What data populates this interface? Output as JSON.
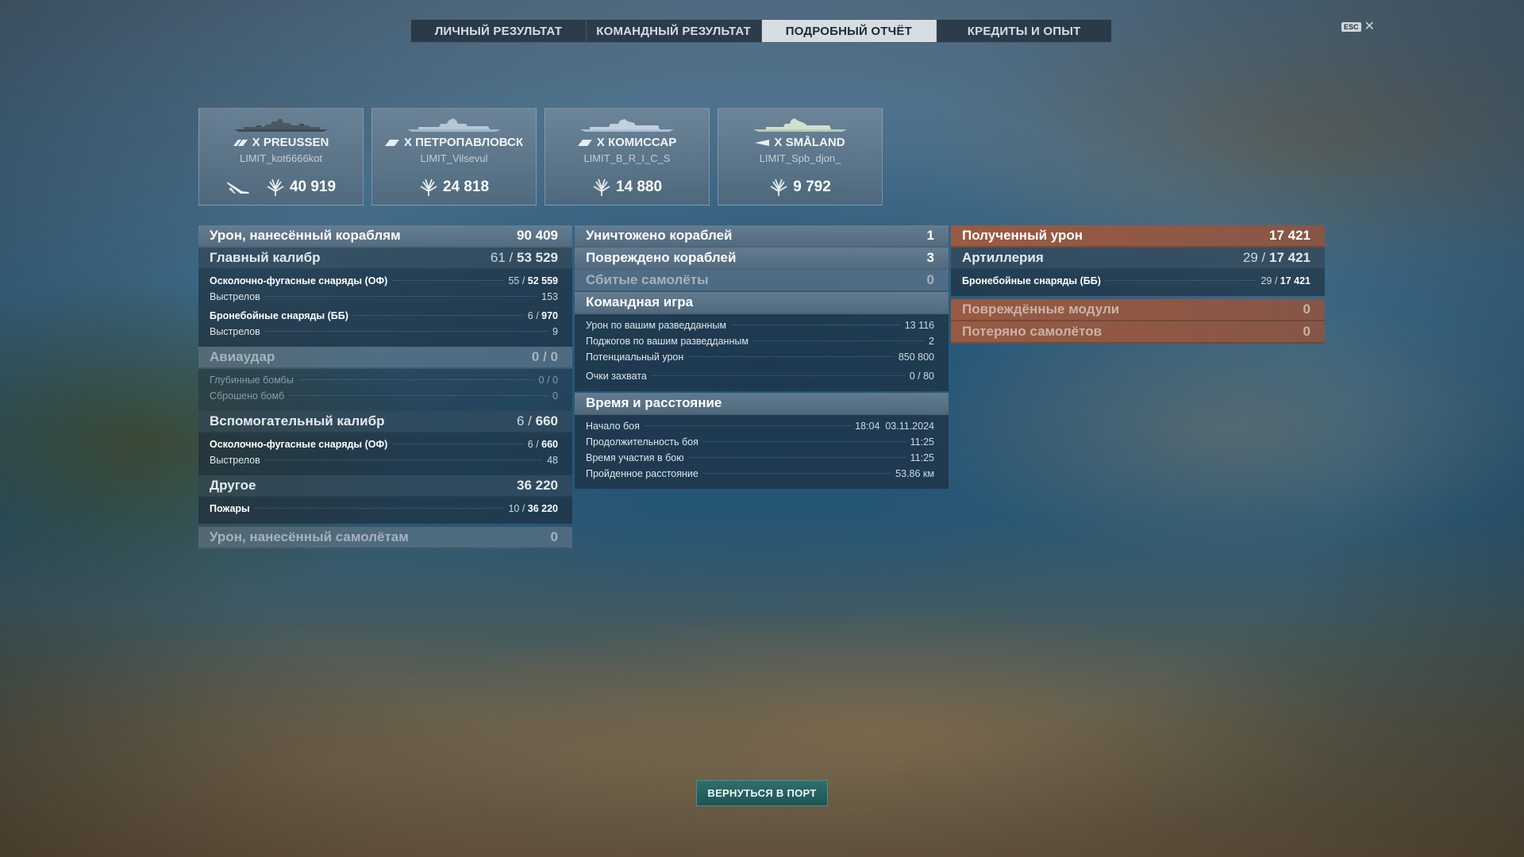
{
  "tabs": [
    "ЛИЧНЫЙ РЕЗУЛЬТАТ",
    "КОМАНДНЫЙ РЕЗУЛЬТАТ",
    "ПОДРОБНЫЙ ОТЧЁТ",
    "КРЕДИТЫ И ОПЫТ"
  ],
  "active_tab": "ПОДРОБНЫЙ ОТЧЁТ",
  "esc": {
    "key": "ESC",
    "close": "✕"
  },
  "ships": [
    {
      "name": "X PREUSSEN",
      "player": "LIMIT_kot6666kot",
      "damage": "40 919",
      "icon": "battleship-icon",
      "has_plane": true
    },
    {
      "name": "X ПЕТРОПАВЛОВСК",
      "player": "LIMIT_Vilsevul",
      "damage": "24 818",
      "icon": "cruiser-icon"
    },
    {
      "name": "X КОМИССАР",
      "player": "LIMIT_B_R_I_C_S",
      "damage": "14 880",
      "icon": "cruiser-icon"
    },
    {
      "name": "X SMÅLAND",
      "player": "LIMIT_Spb_djon_",
      "damage": "9 792",
      "icon": "destroyer-icon"
    }
  ],
  "col1": {
    "ship_damage": {
      "label": "Урон, нанесённый кораблям",
      "value": "90 409"
    },
    "main_battery": {
      "label": "Главный калибр",
      "hits": "61",
      "damage": "53 529",
      "rows": [
        {
          "label": "Осколочно-фугасные снаряды (ОФ)",
          "hits": "55",
          "damage": "52 559"
        },
        {
          "label": "Выстрелов",
          "value": "153"
        },
        {
          "label": "Бронебойные снаряды (ББ)",
          "hits": "6",
          "damage": "970"
        },
        {
          "label": "Выстрелов",
          "value": "9"
        }
      ]
    },
    "airstrike": {
      "label": "Авиаудар",
      "hits": "0",
      "damage": "0",
      "rows": [
        {
          "label": "Глубинные бомбы",
          "hits": "0",
          "damage": "0"
        },
        {
          "label": "Сброшено бомб",
          "value": "0"
        }
      ]
    },
    "secondary": {
      "label": "Вспомогательный калибр",
      "hits": "6",
      "damage": "660",
      "rows": [
        {
          "label": "Осколочно-фугасные снаряды (ОФ)",
          "hits": "6",
          "damage": "660"
        },
        {
          "label": "Выстрелов",
          "value": "48"
        }
      ]
    },
    "other": {
      "label": "Другое",
      "value": "36 220",
      "rows": [
        {
          "label": "Пожары",
          "hits": "10",
          "damage": "36 220"
        }
      ]
    },
    "plane_damage": {
      "label": "Урон, нанесённый самолётам",
      "value": "0"
    }
  },
  "col2": {
    "destroyed": {
      "label": "Уничтожено кораблей",
      "value": "1"
    },
    "damaged": {
      "label": "Повреждено кораблей",
      "value": "3"
    },
    "planes": {
      "label": "Сбитые самолёты",
      "value": "0"
    },
    "team": {
      "label": "Командная игра",
      "rows": [
        {
          "label": "Урон по вашим разведданным",
          "value": "13 116"
        },
        {
          "label": "Поджогов по вашим разведданным",
          "value": "2"
        },
        {
          "label": "Потенциальный урон",
          "value": "850 800"
        },
        {
          "label": "Очки захвата",
          "value": "0 / 80"
        }
      ]
    },
    "time": {
      "label": "Время и расстояние",
      "rows": [
        {
          "label": "Начало боя",
          "value": "18:04  03.11.2024"
        },
        {
          "label": "Продолжительность боя",
          "value": "11:25"
        },
        {
          "label": "Время участия в бою",
          "value": "11:25"
        },
        {
          "label": "Пройденное расстояние",
          "value": "53.86 км"
        }
      ]
    }
  },
  "col3": {
    "received": {
      "label": "Полученный урон",
      "value": "17 421"
    },
    "artillery": {
      "label": "Артиллерия",
      "hits": "29",
      "damage": "17 421",
      "rows": [
        {
          "label": "Бронебойные снаряды (ББ)",
          "hits": "29",
          "damage": "17 421"
        }
      ]
    },
    "modules": {
      "label": "Повреждённые модули",
      "value": "0"
    },
    "lost_planes": {
      "label": "Потеряно самолётов",
      "value": "0"
    }
  },
  "return_button": "ВЕРНУТЬСЯ В ПОРТ",
  "colors": {
    "active_tab": "#d6dde2",
    "received_header": "#a55a3c",
    "return_button": "#2f6f6c"
  }
}
